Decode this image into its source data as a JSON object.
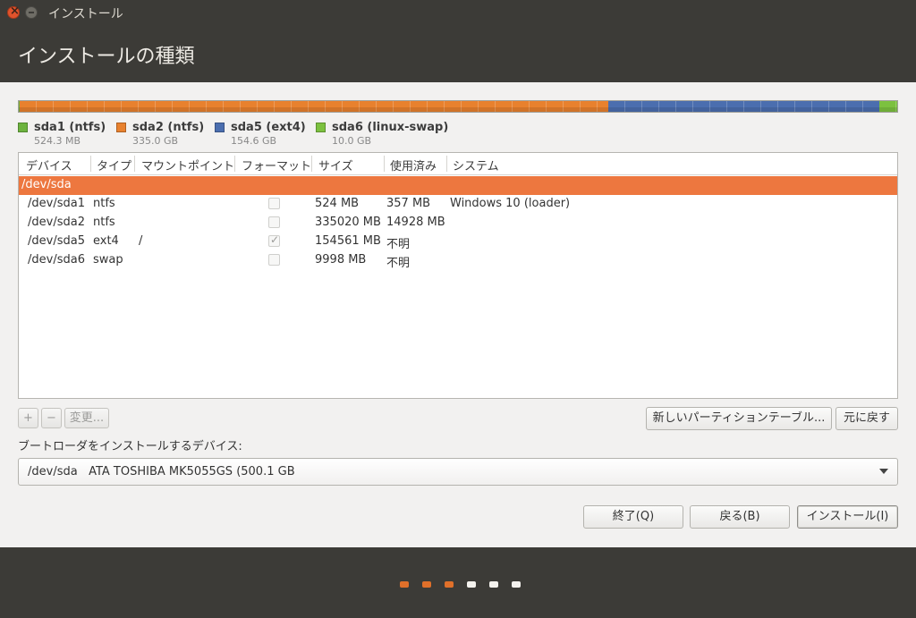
{
  "window": {
    "title": "インストール"
  },
  "page": {
    "title": "インストールの種類"
  },
  "partition_bar": {
    "segments": [
      {
        "name": "sda1",
        "fraction": 0.001,
        "color": "#6db33f"
      },
      {
        "name": "sda2",
        "fraction": 0.67,
        "color": "#e8812e"
      },
      {
        "name": "sda5",
        "fraction": 0.309,
        "color": "#4b6eaf"
      },
      {
        "name": "sda6",
        "fraction": 0.02,
        "color": "#7cc13f"
      }
    ]
  },
  "legend": [
    {
      "name": "sda1 (ntfs)",
      "size": "524.3 MB",
      "color": "#6db33f"
    },
    {
      "name": "sda2 (ntfs)",
      "size": "335.0 GB",
      "color": "#e8812e"
    },
    {
      "name": "sda5 (ext4)",
      "size": "154.6 GB",
      "color": "#4b6eaf"
    },
    {
      "name": "sda6 (linux-swap)",
      "size": "10.0 GB",
      "color": "#7cc13f"
    }
  ],
  "table": {
    "headers": [
      "デバイス",
      "タイプ",
      "マウントポイント",
      "フォーマット",
      "サイズ",
      "使用済み",
      "システム"
    ],
    "disk_row": "/dev/sda",
    "rows": [
      {
        "device": "/dev/sda1",
        "type": "ntfs",
        "mount": "",
        "format": false,
        "size": "524 MB",
        "used": "357 MB",
        "system": "Windows 10 (loader)"
      },
      {
        "device": "/dev/sda2",
        "type": "ntfs",
        "mount": "",
        "format": false,
        "size": "335020 MB",
        "used": "14928 MB",
        "system": ""
      },
      {
        "device": "/dev/sda5",
        "type": "ext4",
        "mount": "/",
        "format": true,
        "size": "154561 MB",
        "used": "不明",
        "system": ""
      },
      {
        "device": "/dev/sda6",
        "type": "swap",
        "mount": "",
        "format": false,
        "size": "9998 MB",
        "used": "不明",
        "system": ""
      }
    ]
  },
  "toolbar": {
    "add": "+",
    "remove": "−",
    "change": "変更...",
    "new_table": "新しいパーティションテーブル...",
    "revert": "元に戻す"
  },
  "bootloader": {
    "label": "ブートローダをインストールするデバイス:",
    "selected": "/dev/sda   ATA TOSHIBA MK5055GS (500.1 GB"
  },
  "actions": {
    "quit": "終了(Q)",
    "back": "戻る(B)",
    "install": "インストール(I)"
  },
  "progress": {
    "total_steps": 6,
    "completed_steps": 3,
    "active_color": "#e0702a",
    "inactive_color": "#f4f2ee"
  }
}
